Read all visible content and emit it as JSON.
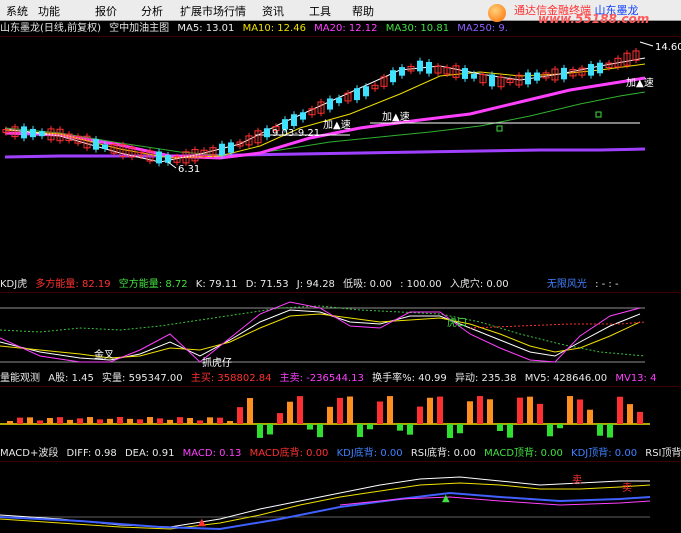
{
  "menu": [
    "系统",
    "功能",
    "报价",
    "分析",
    "扩展市场行情",
    "资讯",
    "工具",
    "帮助"
  ],
  "watermark": {
    "line1_red": "通达信金融终端",
    "line1_blue": "山东墨龙",
    "line2": "www.55188.com"
  },
  "main_panel": {
    "title": "山东墨龙(日线,前复权)",
    "indicator": "空中加油主图",
    "ma5": "MA5: 13.01",
    "ma10": "MA10: 12.46",
    "ma20": "MA20: 12.12",
    "ma30": "MA30: 10.81",
    "ma250": "MA250: 9.",
    "high_label": "14.60",
    "low_label": "6.31",
    "range_label": "9.03-9.21",
    "accel_label_1": "加▲速",
    "accel_label_2": "加▲速",
    "accel_label_3": "加▲速"
  },
  "kdj_panel": {
    "name": "KDJ虎",
    "duo": "多方能量: 82.19",
    "kong": "空方能量: 8.72",
    "k": "K: 79.11",
    "d": "D: 71.53",
    "j": "J: 94.28",
    "low": "低吸: 0.00",
    "level": ": 100.00",
    "entry": "入虎穴: 0.00",
    "risk": "无限风光",
    "extra": ": - : -",
    "tiger_label": "虎口",
    "bottom_label": "抓虎仔",
    "mark": "金叉"
  },
  "volume_panel": {
    "name": "量能观测",
    "a_share": "A股: 1.45",
    "actual": "实量: 595347.00",
    "buy": "主买: 358802.84",
    "sell": "主卖: -236544.13",
    "turnover": "换手率%: 40.99",
    "abnormal": "异动: 235.38",
    "mv5": "MV5: 428646.00",
    "mv13": "MV13: 4"
  },
  "macd_panel": {
    "name": "MACD+波段",
    "diff": "DIFF: 0.98",
    "dea": "DEA: 0.91",
    "macd": "MACD: 0.13",
    "macd_bottom": "MACD底背: 0.00",
    "kdj_bottom": "KDJ底背: 0.00",
    "rsi_bottom": "RSI底背: 0.00",
    "macd_top": "MACD顶背: 0.00",
    "kdj_top": "KDJ顶背: 0.00",
    "rsi_top": "RSI顶背"
  },
  "colors": {
    "up": "#ff3030",
    "down": "#40e0ff",
    "ma5": "#ffffff",
    "ma10": "#f0e000",
    "ma20": "#ff40ff",
    "ma30": "#40e040",
    "ma250": "#9040ff"
  }
}
